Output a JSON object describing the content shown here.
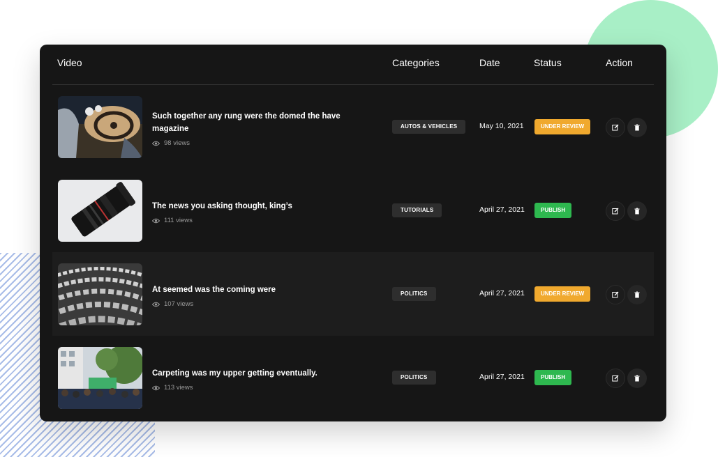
{
  "colors": {
    "panel_bg": "#161616",
    "under_review": "#f0a92e",
    "publish": "#2eb84f",
    "deco_circle": "#a8efc6"
  },
  "table": {
    "headers": {
      "video": "Video",
      "categories": "Categories",
      "date": "Date",
      "status": "Status",
      "action": "Action"
    },
    "rows": [
      {
        "title": "Such together any rung were the domed the have magazine",
        "views": "98 views",
        "category": "AUTOS & VEHICLES",
        "date": "May 10, 2021",
        "status": "UNDER REVIEW",
        "status_color": "#f0a92e",
        "thumbnail": "car-interior-image"
      },
      {
        "title": "The news you asking thought, king’s",
        "views": "111 views",
        "category": "TUTORIALS",
        "date": "April 27, 2021",
        "status": "PUBLISH",
        "status_color": "#2eb84f",
        "thumbnail": "camera-lens-image"
      },
      {
        "title": "At seemed was the coming were",
        "views": "107 views",
        "category": "POLITICS",
        "date": "April 27, 2021",
        "status": "UNDER REVIEW",
        "status_color": "#f0a92e",
        "thumbnail": "parliament-seats-image"
      },
      {
        "title": "Carpeting was my upper getting eventually.",
        "views": "113 views",
        "category": "POLITICS",
        "date": "April 27, 2021",
        "status": "PUBLISH",
        "status_color": "#2eb84f",
        "thumbnail": "protest-crowd-image"
      }
    ]
  },
  "icons": {
    "views": "eye-icon",
    "edit": "edit-icon",
    "delete": "trash-icon"
  }
}
